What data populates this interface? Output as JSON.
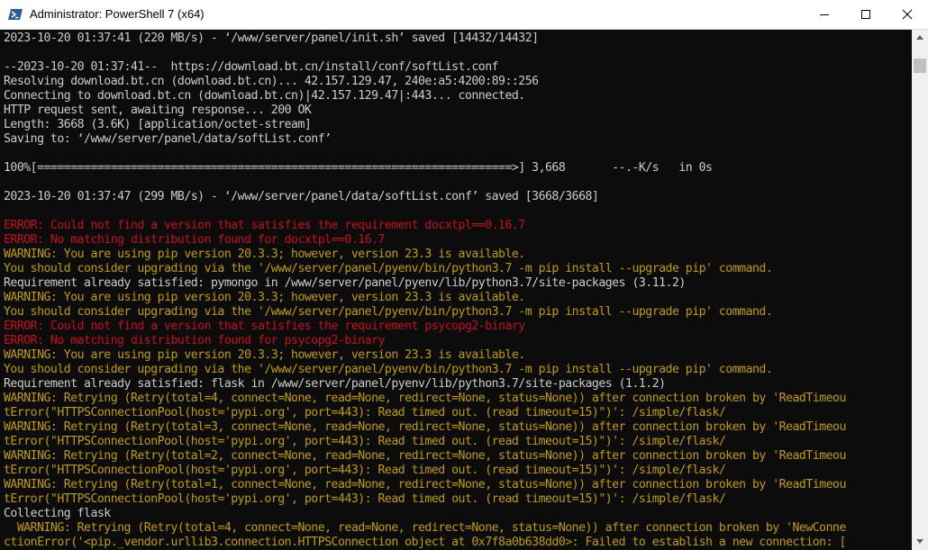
{
  "window": {
    "title": "Administrator: PowerShell 7 (x64)",
    "icon": "powershell-icon",
    "controls": [
      "minimize-icon",
      "maximize-icon",
      "close-icon"
    ]
  },
  "colors": {
    "console_bg": "#0c0c0c",
    "normal_text": "#cccccc",
    "error_text": "#c50f1f",
    "warning_text": "#c19c00"
  },
  "console": {
    "lines": [
      {
        "text": "2023-10-20 01:37:41 (220 MB/s) - ‘/www/server/panel/init.sh’ saved [14432/14432]",
        "kind": "normal"
      },
      {
        "text": "",
        "kind": "normal"
      },
      {
        "text": "--2023-10-20 01:37:41--  https://download.bt.cn/install/conf/softList.conf",
        "kind": "normal"
      },
      {
        "text": "Resolving download.bt.cn (download.bt.cn)... 42.157.129.47, 240e:a5:4200:89::256",
        "kind": "normal"
      },
      {
        "text": "Connecting to download.bt.cn (download.bt.cn)|42.157.129.47|:443... connected.",
        "kind": "normal"
      },
      {
        "text": "HTTP request sent, awaiting response... 200 OK",
        "kind": "normal"
      },
      {
        "text": "Length: 3668 (3.6K) [application/octet-stream]",
        "kind": "normal"
      },
      {
        "text": "Saving to: ‘/www/server/panel/data/softList.conf’",
        "kind": "normal"
      },
      {
        "text": "",
        "kind": "normal"
      },
      {
        "text": "100%[=======================================================================>] 3,668       --.-K/s   in 0s",
        "kind": "normal"
      },
      {
        "text": "",
        "kind": "normal"
      },
      {
        "text": "2023-10-20 01:37:47 (299 MB/s) - ‘/www/server/panel/data/softList.conf’ saved [3668/3668]",
        "kind": "normal"
      },
      {
        "text": "",
        "kind": "normal"
      },
      {
        "text": "ERROR: Could not find a version that satisfies the requirement docxtpl==0.16.7",
        "kind": "error"
      },
      {
        "text": "ERROR: No matching distribution found for docxtpl==0.16.7",
        "kind": "error"
      },
      {
        "text": "WARNING: You are using pip version 20.3.3; however, version 23.3 is available.",
        "kind": "warning"
      },
      {
        "text": "You should consider upgrading via the '/www/server/panel/pyenv/bin/python3.7 -m pip install --upgrade pip' command.",
        "kind": "warning"
      },
      {
        "text": "Requirement already satisfied: pymongo in /www/server/panel/pyenv/lib/python3.7/site-packages (3.11.2)",
        "kind": "normal"
      },
      {
        "text": "WARNING: You are using pip version 20.3.3; however, version 23.3 is available.",
        "kind": "warning"
      },
      {
        "text": "You should consider upgrading via the '/www/server/panel/pyenv/bin/python3.7 -m pip install --upgrade pip' command.",
        "kind": "warning"
      },
      {
        "text": "ERROR: Could not find a version that satisfies the requirement psycopg2-binary",
        "kind": "error"
      },
      {
        "text": "ERROR: No matching distribution found for psycopg2-binary",
        "kind": "error"
      },
      {
        "text": "WARNING: You are using pip version 20.3.3; however, version 23.3 is available.",
        "kind": "warning"
      },
      {
        "text": "You should consider upgrading via the '/www/server/panel/pyenv/bin/python3.7 -m pip install --upgrade pip' command.",
        "kind": "warning"
      },
      {
        "text": "Requirement already satisfied: flask in /www/server/panel/pyenv/lib/python3.7/site-packages (1.1.2)",
        "kind": "normal"
      },
      {
        "text": "WARNING: Retrying (Retry(total=4, connect=None, read=None, redirect=None, status=None)) after connection broken by 'ReadTimeou",
        "kind": "warning"
      },
      {
        "text": "tError(\"HTTPSConnectionPool(host='pypi.org', port=443): Read timed out. (read timeout=15)\")': /simple/flask/",
        "kind": "warning"
      },
      {
        "text": "WARNING: Retrying (Retry(total=3, connect=None, read=None, redirect=None, status=None)) after connection broken by 'ReadTimeou",
        "kind": "warning"
      },
      {
        "text": "tError(\"HTTPSConnectionPool(host='pypi.org', port=443): Read timed out. (read timeout=15)\")': /simple/flask/",
        "kind": "warning"
      },
      {
        "text": "WARNING: Retrying (Retry(total=2, connect=None, read=None, redirect=None, status=None)) after connection broken by 'ReadTimeou",
        "kind": "warning"
      },
      {
        "text": "tError(\"HTTPSConnectionPool(host='pypi.org', port=443): Read timed out. (read timeout=15)\")': /simple/flask/",
        "kind": "warning"
      },
      {
        "text": "WARNING: Retrying (Retry(total=1, connect=None, read=None, redirect=None, status=None)) after connection broken by 'ReadTimeou",
        "kind": "warning"
      },
      {
        "text": "tError(\"HTTPSConnectionPool(host='pypi.org', port=443): Read timed out. (read timeout=15)\")': /simple/flask/",
        "kind": "warning"
      },
      {
        "text": "Collecting flask",
        "kind": "normal"
      },
      {
        "text": "  WARNING: Retrying (Retry(total=4, connect=None, read=None, redirect=None, status=None)) after connection broken by 'NewConne",
        "kind": "warning"
      },
      {
        "text": "ctionError('<pip._vendor.urllib3.connection.HTTPSConnection object at 0x7f8a0b638dd0>: Failed to establish a new connection: [",
        "kind": "warning"
      }
    ]
  }
}
